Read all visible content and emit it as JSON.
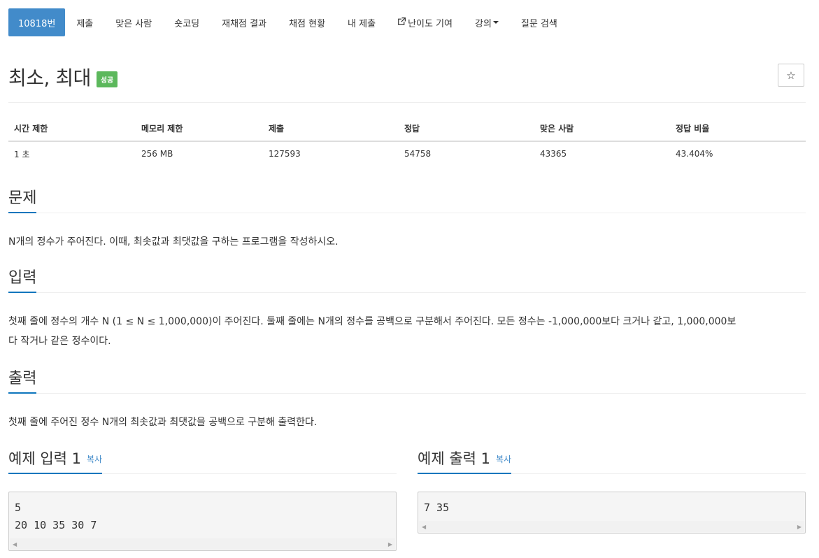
{
  "tabs": [
    {
      "label": "10818번",
      "active": true
    },
    {
      "label": "제출"
    },
    {
      "label": "맞은 사람"
    },
    {
      "label": "숏코딩"
    },
    {
      "label": "재채점 결과"
    },
    {
      "label": "채점 현황"
    },
    {
      "label": "내 제출"
    },
    {
      "label": "난이도 기여",
      "icon": "external-link-icon"
    },
    {
      "label": "강의",
      "icon": "caret-down-icon"
    },
    {
      "label": "질문 검색"
    }
  ],
  "problem": {
    "title": "최소, 최대",
    "badge": "성공",
    "badge_color": "#5cb85c",
    "star_icon": "☆"
  },
  "info": {
    "headers": [
      "시간 제한",
      "메모리 제한",
      "제출",
      "정답",
      "맞은 사람",
      "정답 비율"
    ],
    "values": [
      "1 초",
      "256 MB",
      "127593",
      "54758",
      "43365",
      "43.404%"
    ]
  },
  "sections": {
    "problem": {
      "heading": "문제",
      "text": "N개의 정수가 주어진다. 이때, 최솟값과 최댓값을 구하는 프로그램을 작성하시오."
    },
    "input": {
      "heading": "입력",
      "line1": "첫째 줄에 정수의 개수 N (1 ≤ N ≤ 1,000,000)이 주어진다. 둘째 줄에는 N개의 정수를 공백으로 구분해서 주어진다. 모든 정수는 -1,000,000보다 크거나 같고, 1,000,000보",
      "line2": "다 작거나 같은 정수이다."
    },
    "output": {
      "heading": "출력",
      "text": "첫째 줄에 주어진 정수 N개의 최솟값과 최댓값을 공백으로 구분해 출력한다."
    }
  },
  "samples": {
    "input": {
      "heading": "예제 입력 1",
      "copy_label": "복사",
      "lines": [
        "5",
        "20 10 35 30 7"
      ]
    },
    "output": {
      "heading": "예제 출력 1",
      "copy_label": "복사",
      "lines": [
        "7 35"
      ]
    }
  },
  "colors": {
    "accent": "#428bca",
    "headline_underline": "#0e76bd",
    "success": "#5cb85c"
  }
}
